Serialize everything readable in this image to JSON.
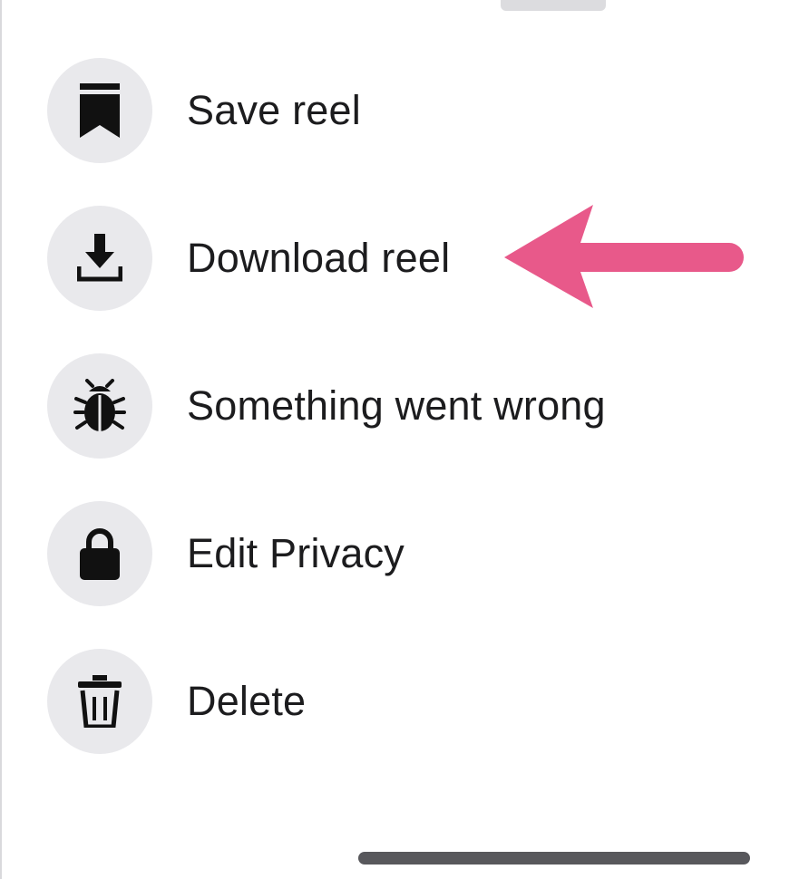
{
  "menu": {
    "items": [
      {
        "label": "Save reel",
        "icon": "bookmark-icon"
      },
      {
        "label": "Download reel",
        "icon": "download-icon"
      },
      {
        "label": "Something went wrong",
        "icon": "bug-icon"
      },
      {
        "label": "Edit Privacy",
        "icon": "lock-icon"
      },
      {
        "label": "Delete",
        "icon": "trash-icon"
      }
    ]
  },
  "annotation": {
    "arrow_color": "#e8598a",
    "points_to": "Download reel"
  },
  "colors": {
    "icon_background": "#e9e9ec",
    "text": "#1c1c1e",
    "home_indicator": "#58585c"
  }
}
